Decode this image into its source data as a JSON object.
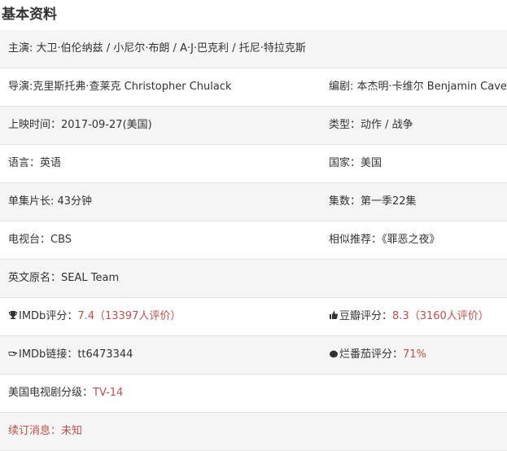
{
  "section": {
    "title": "基本资料"
  },
  "rows": {
    "cast": {
      "label": "主演: ",
      "value": "大卫·伯伦纳兹 / 小尼尔·布朗 / A·J·巴克利 / 托尼·特拉克斯"
    },
    "director": {
      "label": "导演:",
      "value": "克里斯托弗·查莱克 Christopher Chulack"
    },
    "writer": {
      "label": "编剧: ",
      "value": "本杰明·卡维尔 Benjamin Cavell"
    },
    "release": {
      "label": "上映时间：",
      "value": "2017-09-27(美国)"
    },
    "genre": {
      "label": "类型：",
      "value": "动作 / 战争"
    },
    "language": {
      "label": "语言：",
      "value": "英语"
    },
    "country": {
      "label": "国家：",
      "value": "美国"
    },
    "runtime": {
      "label": "单集片长: ",
      "value": "43分钟"
    },
    "episodes": {
      "label": "集数：",
      "value": "第一季22集"
    },
    "network": {
      "label": "电视台：",
      "value": "CBS"
    },
    "similar": {
      "label": "相似推荐：",
      "value": "《罪恶之夜》"
    },
    "original_title": {
      "label": "英文原名：",
      "value": "SEAL Team"
    },
    "imdb_score": {
      "label": "IMDb评分：",
      "score": "7.4",
      "count": "（13397人评价）"
    },
    "douban_score": {
      "label": "豆瓣评分：",
      "score": "8.3",
      "count": "（3160人评价）"
    },
    "imdb_link": {
      "label": "IMDb链接：",
      "value": "tt6473344"
    },
    "rotten_score": {
      "label": "烂番茄评分：",
      "value": "71%"
    },
    "us_rating": {
      "label": "美国电视剧分级：",
      "value": "TV-14"
    },
    "renewal": {
      "label": "续订消息：",
      "value": "未知"
    }
  },
  "icons": {
    "imdb_score": "trophy-icon",
    "douban_score": "thumbs-up-icon",
    "imdb_link": "pointing-hand-icon",
    "rotten_score": "tomato-icon"
  },
  "colors": {
    "accent": "#c0504d",
    "row_alt": "#f5f5f5",
    "text": "#333333",
    "divider": "#e3e3e3"
  }
}
